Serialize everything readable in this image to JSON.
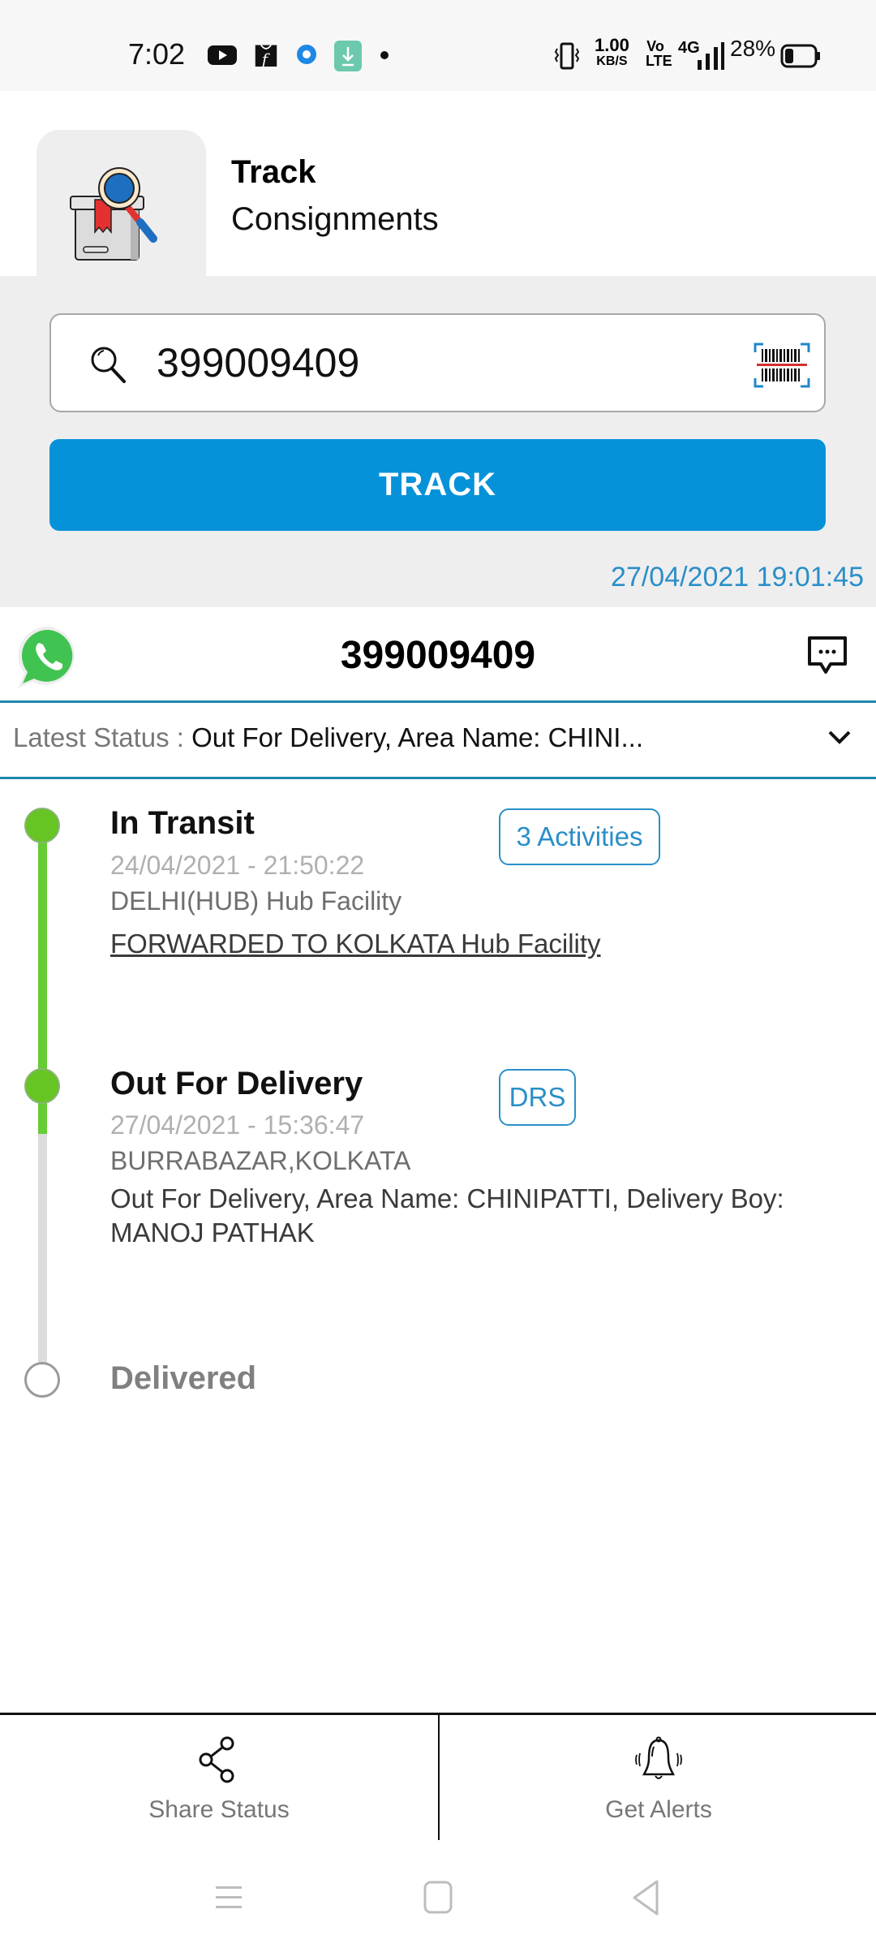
{
  "status_bar": {
    "time": "7:02",
    "left_icons": [
      "youtube-icon",
      "flipkart-icon",
      "app-notification-icon",
      "download-icon",
      "dot-icon"
    ],
    "net_speed_value": "1.00",
    "net_speed_unit": "KB/S",
    "volte": "Vo LTE",
    "network": "4G",
    "battery": "28%"
  },
  "header": {
    "title_line1": "Track",
    "title_line2": "Consignments",
    "logo_icon": "track-consignment-icon"
  },
  "search": {
    "value": "399009409",
    "placeholder": "",
    "search_icon": "search-icon",
    "scan_icon": "barcode-scan-icon"
  },
  "track_button": {
    "label": "TRACK"
  },
  "last_updated": "27/04/2021 19:01:45",
  "consignment": {
    "number": "399009409",
    "whatsapp_icon": "whatsapp-icon",
    "chat_icon": "chat-icon"
  },
  "latest_status": {
    "label": "Latest Status : ",
    "value": "Out For Delivery, Area Name: CHINI..."
  },
  "timeline": [
    {
      "title": "In Transit",
      "datetime": "24/04/2021 - 21:50:22",
      "location": "DELHI(HUB) Hub Facility",
      "description": "FORWARDED TO KOLKATA Hub Facility",
      "badge": "3 Activities",
      "completed": true
    },
    {
      "title": "Out For Delivery",
      "datetime": "27/04/2021 - 15:36:47",
      "location": "BURRABAZAR,KOLKATA",
      "description": "Out For Delivery, Area Name: CHINIPATTI, Delivery Boy: MANOJ PATHAK",
      "badge": "DRS",
      "completed": true
    },
    {
      "title": "Delivered",
      "completed": false
    }
  ],
  "actions": [
    {
      "label": "Share Status",
      "icon": "share-icon"
    },
    {
      "label": "Get Alerts",
      "icon": "bell-icon"
    }
  ],
  "colors": {
    "primary": "#0592d9",
    "accent_text": "#2a8fc8",
    "timeline_done": "#66cc33",
    "timeline_pending": "#dcdcdc"
  }
}
